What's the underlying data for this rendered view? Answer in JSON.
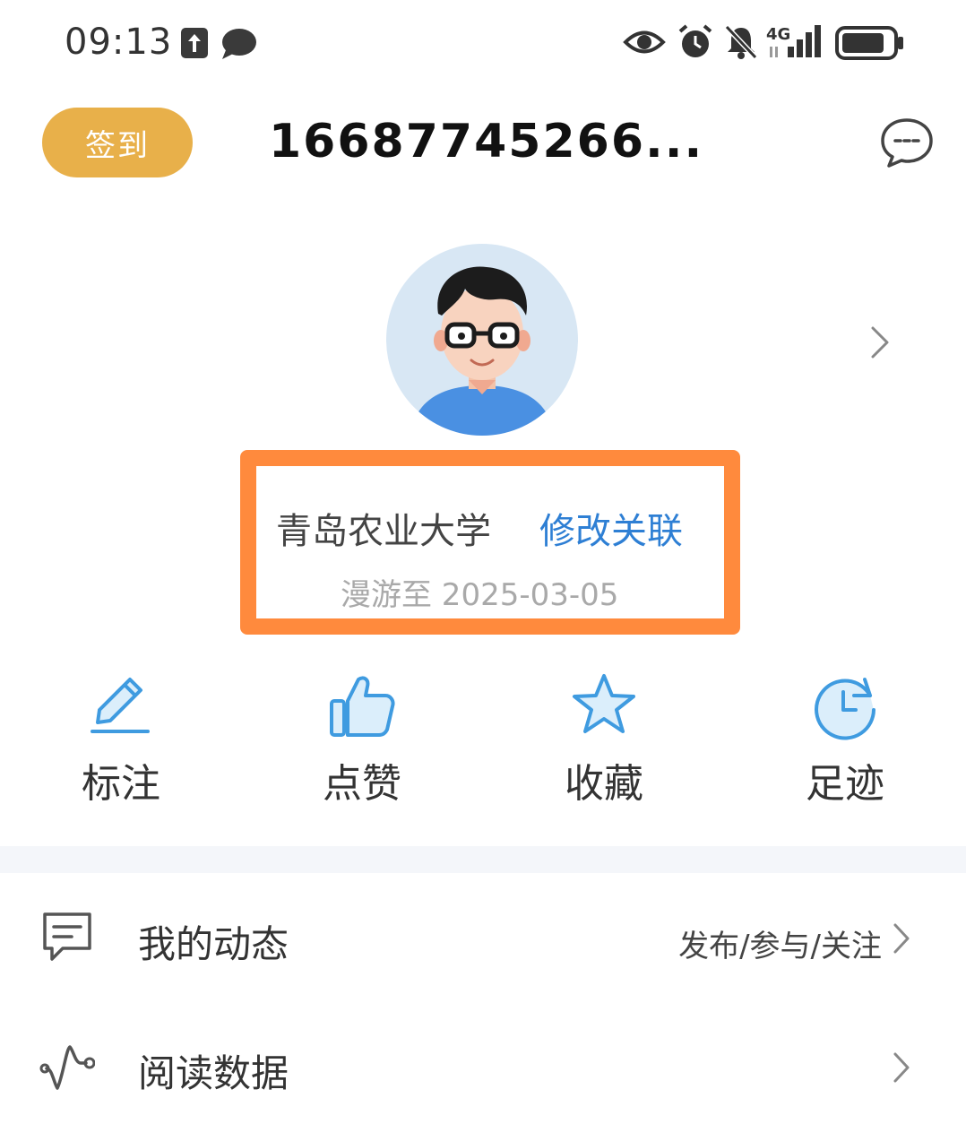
{
  "status_bar": {
    "time": "09:13",
    "network": "4G",
    "icons": [
      "upload-icon",
      "chat-bubble-icon",
      "eye-icon",
      "alarm-icon",
      "bell-off-icon",
      "signal-icon",
      "battery-icon"
    ]
  },
  "header": {
    "checkin_label": "签到",
    "phone": "16687745266...",
    "message_icon": "message-icon"
  },
  "profile": {
    "school": "青岛农业大学",
    "edit_link": "修改关联",
    "roaming": "漫游至 2025-03-05",
    "highlight_color": "#ff8a3d",
    "link_color": "#2e7fd4"
  },
  "actions": [
    {
      "label": "标注",
      "icon": "pencil-icon"
    },
    {
      "label": "点赞",
      "icon": "thumbs-up-icon"
    },
    {
      "label": "收藏",
      "icon": "star-icon"
    },
    {
      "label": "足迹",
      "icon": "clock-history-icon"
    }
  ],
  "menu": [
    {
      "label": "我的动态",
      "sub": "发布/参与/关注",
      "icon": "comment-icon"
    },
    {
      "label": "阅读数据",
      "sub": "",
      "icon": "wave-icon"
    }
  ],
  "colors": {
    "checkin_bg": "#e8b04a",
    "action_icon": "#3f9be0"
  }
}
